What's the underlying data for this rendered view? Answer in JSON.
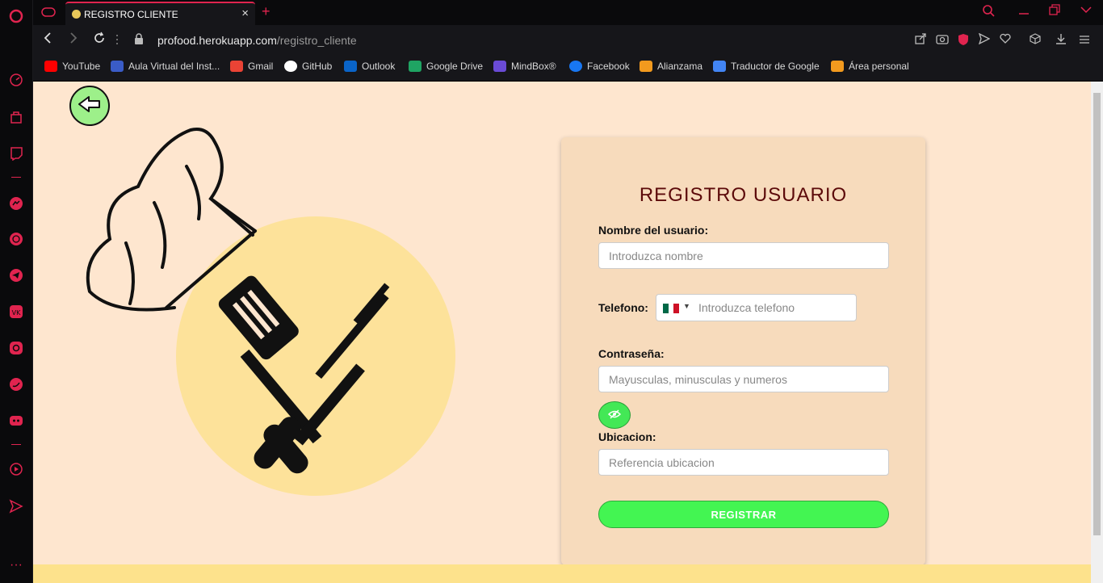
{
  "browser": {
    "tab_title": "REGISTRO CLIENTE",
    "url_host": "profood.herokuapp.com",
    "url_path": "/registro_cliente",
    "bookmarks": [
      {
        "label": "YouTube",
        "icon": "youtube-icon",
        "color": "#ff0000"
      },
      {
        "label": "Aula Virtual del Inst...",
        "icon": "aula-icon",
        "color": "#3a5cc7"
      },
      {
        "label": "Gmail",
        "icon": "gmail-icon",
        "color": "#ea4335"
      },
      {
        "label": "GitHub",
        "icon": "github-icon",
        "color": "#ffffff"
      },
      {
        "label": "Outlook",
        "icon": "outlook-icon",
        "color": "#0a64c8"
      },
      {
        "label": "Google Drive",
        "icon": "drive-icon",
        "color": "#1fa463"
      },
      {
        "label": "MindBox®",
        "icon": "mindbox-icon",
        "color": "#6a4bd6"
      },
      {
        "label": "Facebook",
        "icon": "facebook-icon",
        "color": "#1877f2"
      },
      {
        "label": "Alianzama",
        "icon": "alianzama-icon",
        "color": "#f29a1e"
      },
      {
        "label": "Traductor de Google",
        "icon": "translate-icon",
        "color": "#4285f4"
      },
      {
        "label": "Área personal",
        "icon": "area-personal-icon",
        "color": "#f29a1e"
      }
    ]
  },
  "form": {
    "title": "REGISTRO USUARIO",
    "name_label": "Nombre del usuario:",
    "name_placeholder": "Introduzca nombre",
    "phone_label": "Telefono:",
    "phone_placeholder": "Introduzca telefono",
    "password_label": "Contraseña:",
    "password_placeholder": "Mayusculas, minusculas y numeros",
    "location_label": "Ubicacion:",
    "location_placeholder": "Referencia ubicacion",
    "submit_label": "REGISTRAR"
  },
  "colors": {
    "accent": "#e0244f",
    "page_bg": "#fee6cf",
    "card_bg": "#f7dbbc",
    "submit_bg": "#43f552",
    "circle": "#fde29a"
  }
}
